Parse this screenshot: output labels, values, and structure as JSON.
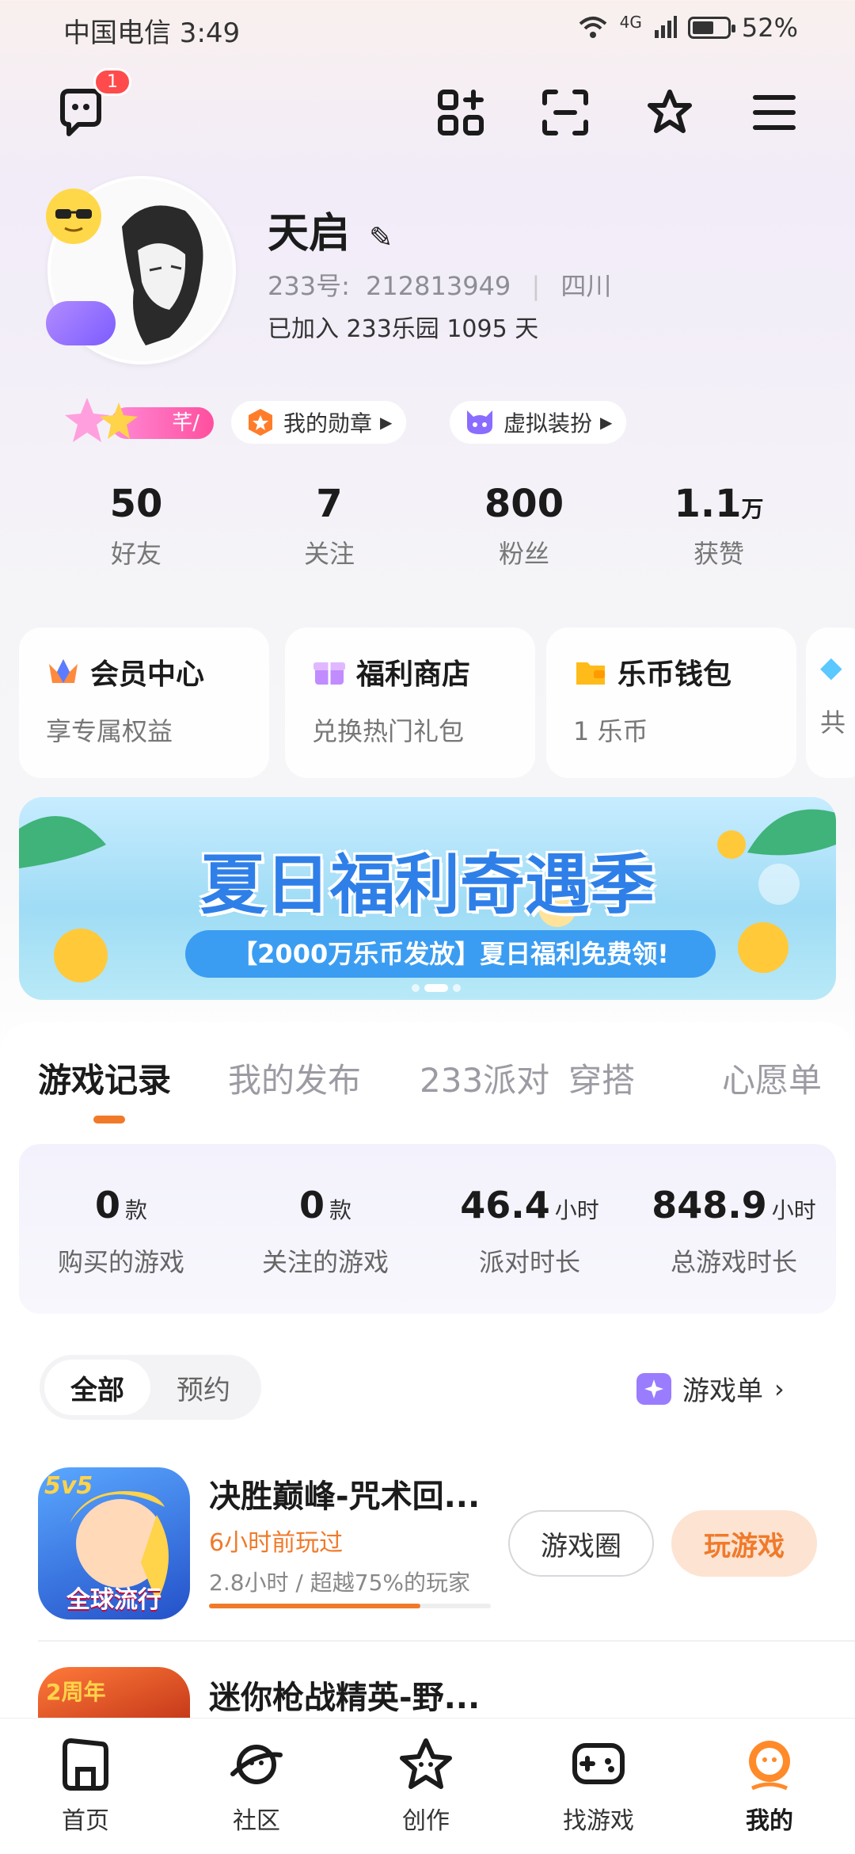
{
  "status_bar": {
    "carrier_time": "中国电信 3:49",
    "network": "4G",
    "battery": "52%"
  },
  "header": {
    "message_badge": "1"
  },
  "profile": {
    "name": "天启",
    "id_label": "233号:",
    "id_value": "212813949",
    "region": "四川",
    "joined": "已加入 233乐园 1095 天",
    "level_tag": "芊/",
    "medal_label": "我的勋章",
    "avatar_dress_label": "虚拟装扮"
  },
  "stats": [
    {
      "value": "50",
      "unit": "",
      "label": "好友"
    },
    {
      "value": "7",
      "unit": "",
      "label": "关注"
    },
    {
      "value": "800",
      "unit": "",
      "label": "粉丝"
    },
    {
      "value": "1.1",
      "unit": "万",
      "label": "获赞"
    }
  ],
  "cards": [
    {
      "title": "会员中心",
      "sub": "享专属权益",
      "icon": "crown-icon"
    },
    {
      "title": "福利商店",
      "sub": "兑换热门礼包",
      "icon": "gift-icon"
    },
    {
      "title": "乐币钱包",
      "sub": "1 乐币",
      "icon": "wallet-icon"
    },
    {
      "title": "",
      "sub": "共",
      "icon": "diamond-icon"
    }
  ],
  "banner": {
    "title": "夏日福利奇遇季",
    "subtitle": "【2000万乐币发放】夏日福利免费领!"
  },
  "tabs": [
    "游戏记录",
    "我的发布",
    "233派对",
    "穿搭",
    "心愿单"
  ],
  "summary": [
    {
      "value": "0",
      "unit": "款",
      "label": "购买的游戏"
    },
    {
      "value": "0",
      "unit": "款",
      "label": "关注的游戏"
    },
    {
      "value": "46.4",
      "unit": "小时",
      "label": "派对时长"
    },
    {
      "value": "848.9",
      "unit": "小时",
      "label": "总游戏时长"
    }
  ],
  "filter": {
    "all": "全部",
    "reserve": "预约",
    "gamelist": "游戏单"
  },
  "games": [
    {
      "name": "决胜巅峰-咒术回...",
      "last_played": "6小时前玩过",
      "playtime": "2.8小时 / 超越75%的玩家",
      "progress": 0.75,
      "icon_text_top": "5v5",
      "icon_text_bottom": "全球流行",
      "circle_button": "游戏圈",
      "play_button": "玩游戏"
    },
    {
      "name": "迷你枪战精英-野...",
      "icon_text_top": "2周年"
    }
  ],
  "nav": [
    {
      "label": "首页",
      "icon": "home-icon"
    },
    {
      "label": "社区",
      "icon": "planet-icon"
    },
    {
      "label": "创作",
      "icon": "star-create-icon"
    },
    {
      "label": "找游戏",
      "icon": "gamepad-icon"
    },
    {
      "label": "我的",
      "icon": "profile-icon"
    }
  ],
  "colors": {
    "accent": "#f07a2a",
    "accent_light": "#fde3d2",
    "badge": "#ff4b4b"
  }
}
